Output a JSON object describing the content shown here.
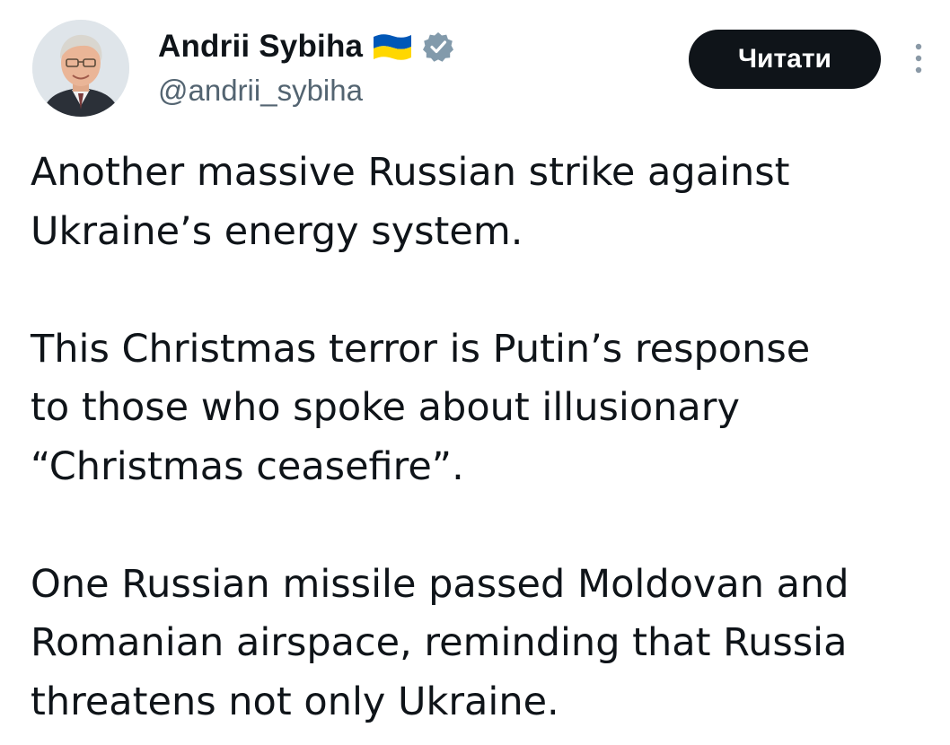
{
  "author": {
    "display_name": "Andrii Sybiha",
    "handle": "@andrii_sybiha",
    "flag_emoji": "ukraine-flag-icon",
    "verified_badge": "verified-icon",
    "colors": {
      "flag_blue": "#0057b7",
      "flag_yellow": "#ffd700",
      "verified": "#829aab"
    }
  },
  "actions": {
    "follow_label": "Читати",
    "more_icon": "more-vertical-icon"
  },
  "tweet": {
    "paragraphs": [
      {
        "lines": [
          "Another massive Russian strike against",
          "Ukraine’s energy system."
        ]
      },
      {
        "lines": [
          "This Christmas terror is Putin’s response",
          "to those who spoke about illusionary",
          "“Christmas ceasefire”."
        ]
      },
      {
        "lines": [
          "One Russian missile passed Moldovan and",
          "Romanian airspace, reminding that Russia",
          "threatens not only Ukraine."
        ]
      }
    ]
  }
}
